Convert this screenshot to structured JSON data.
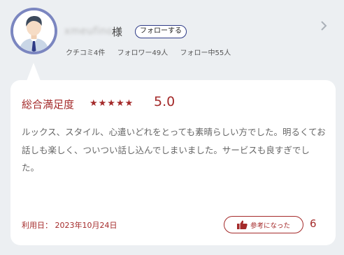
{
  "profile": {
    "username": "xmeufino",
    "honorific": "様",
    "follow_label": "フォローする",
    "stats": {
      "reviews": "クチコミ4件",
      "followers": "フォロワー49人",
      "following": "フォロー中55人"
    }
  },
  "review": {
    "rating_label": "総合満足度",
    "stars": "★★★★★",
    "rating": 5.0,
    "score_text": "5.0",
    "body": "ルックス、スタイル、心遣いどれをとっても素晴らしい方でした。明るくてお話しも楽しく、ついつい話し込んでしまいました。サービスも良すぎでした。",
    "date": "利用日： 2023年10月24日",
    "helpful_label": "参考になった",
    "helpful_count": "6"
  },
  "colors": {
    "accent": "#a42a2a",
    "avatar_ring": "#7b86c0",
    "follow_border": "#2d3a86",
    "background": "#eceff2"
  },
  "icons": {
    "avatar": "user-avatar-icon",
    "chevron": "chevron-right-icon",
    "thumb": "thumbs-up-icon"
  }
}
